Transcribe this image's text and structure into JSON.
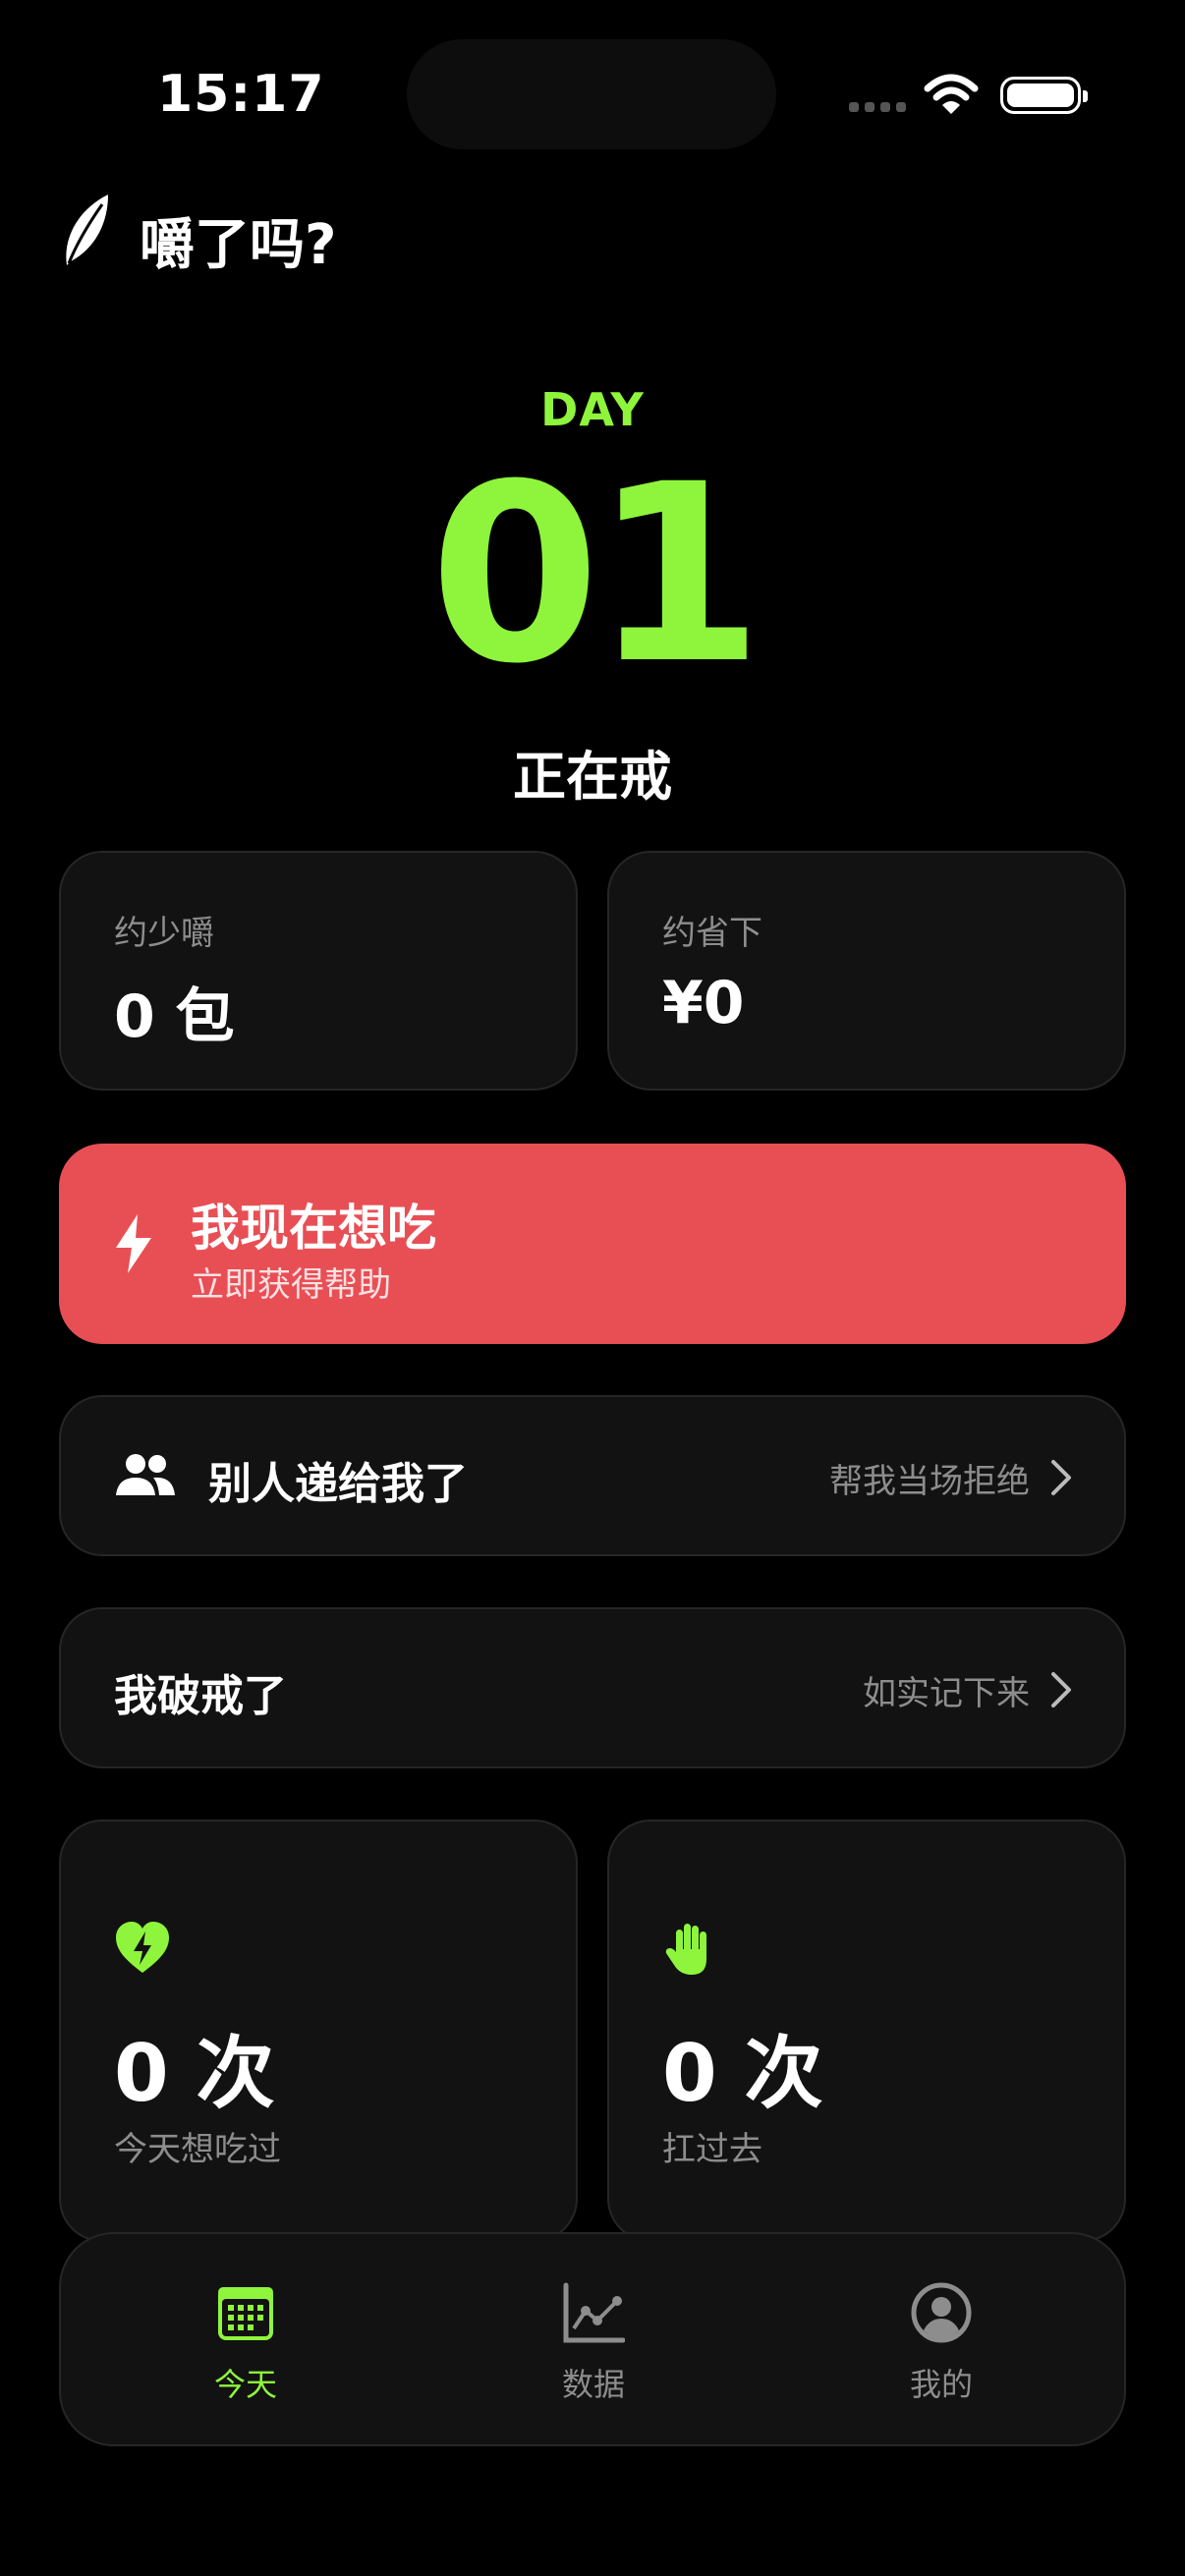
{
  "status_bar": {
    "time": "15:17"
  },
  "app": {
    "title": "嚼了吗?"
  },
  "hero": {
    "day_label": "DAY",
    "day_number": "01",
    "status": "正在戒"
  },
  "stats": [
    {
      "label": "约少嚼",
      "value": "0 包"
    },
    {
      "label": "约省下",
      "value": "¥0"
    }
  ],
  "craving_button": {
    "title": "我现在想吃",
    "subtitle": "立即获得帮助"
  },
  "offered_row": {
    "label": "别人递给我了",
    "action": "帮我当场拒绝"
  },
  "relapse_row": {
    "label": "我破戒了",
    "action": "如实记下来"
  },
  "counters": [
    {
      "icon": "heart-bolt-icon",
      "value": "0 次",
      "label": "今天想吃过"
    },
    {
      "icon": "hand-icon",
      "value": "0 次",
      "label": "扛过去"
    }
  ],
  "tabs": [
    {
      "label": "今天",
      "icon": "calendar-icon",
      "active": true
    },
    {
      "label": "数据",
      "icon": "chart-icon",
      "active": false
    },
    {
      "label": "我的",
      "icon": "profile-icon",
      "active": false
    }
  ],
  "colors": {
    "accent": "#8ef53c",
    "danger": "#e84f55",
    "card": "#121212",
    "muted": "#8d8d8d"
  }
}
